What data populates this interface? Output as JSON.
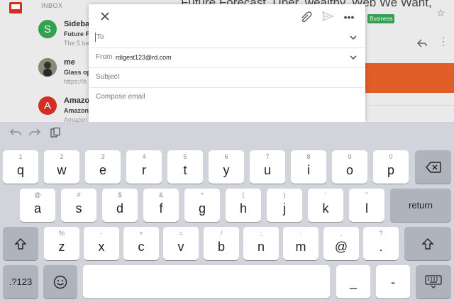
{
  "inbox": {
    "label": "INBOX",
    "emails": [
      {
        "avatar_letter": "S",
        "avatar_color": "#34a853",
        "sender": "Sideba",
        "subject": "Future F",
        "snippet": "The 5 be"
      },
      {
        "avatar_letter": "",
        "avatar_color": "#6b6b6b",
        "sender": "me",
        "subject": "Glass op",
        "snippet": "https://b"
      },
      {
        "avatar_letter": "A",
        "avatar_color": "#d93025",
        "sender": "Amazon",
        "subject": "Amazon",
        "snippet": "Amazon"
      }
    ]
  },
  "reading_pane": {
    "headline": "Future Forecast, Uber, wealthy, Web We Want,",
    "badge": "Business"
  },
  "compose": {
    "to_label": "To",
    "from_label": "From",
    "from_value": "rdigest123@rd.com",
    "subject_placeholder": "Subject",
    "body_placeholder": "Compose email"
  },
  "keyboard": {
    "row1": [
      {
        "hint": "1",
        "key": "q"
      },
      {
        "hint": "2",
        "key": "w"
      },
      {
        "hint": "3",
        "key": "e"
      },
      {
        "hint": "4",
        "key": "r"
      },
      {
        "hint": "5",
        "key": "t"
      },
      {
        "hint": "6",
        "key": "y"
      },
      {
        "hint": "7",
        "key": "u"
      },
      {
        "hint": "8",
        "key": "i"
      },
      {
        "hint": "9",
        "key": "o"
      },
      {
        "hint": "0",
        "key": "p"
      }
    ],
    "row2": [
      {
        "hint": "@",
        "key": "a"
      },
      {
        "hint": "#",
        "key": "s"
      },
      {
        "hint": "$",
        "key": "d"
      },
      {
        "hint": "&",
        "key": "f"
      },
      {
        "hint": "*",
        "key": "g"
      },
      {
        "hint": "(",
        "key": "h"
      },
      {
        "hint": ")",
        "key": "j"
      },
      {
        "hint": "'",
        "key": "k"
      },
      {
        "hint": "\"",
        "key": "l"
      }
    ],
    "row3": [
      {
        "hint": "%",
        "key": "z"
      },
      {
        "hint": "-",
        "key": "x"
      },
      {
        "hint": "+",
        "key": "c"
      },
      {
        "hint": "=",
        "key": "v"
      },
      {
        "hint": "/",
        "key": "b"
      },
      {
        "hint": ";",
        "key": "n"
      },
      {
        "hint": ":",
        "key": "m"
      },
      {
        "hint": ",",
        "key": "@"
      },
      {
        "hint": "?",
        "key": "."
      }
    ],
    "return_label": "return",
    "numbers_label": ".?123",
    "underscore_label": "_",
    "dash_label": "-"
  }
}
